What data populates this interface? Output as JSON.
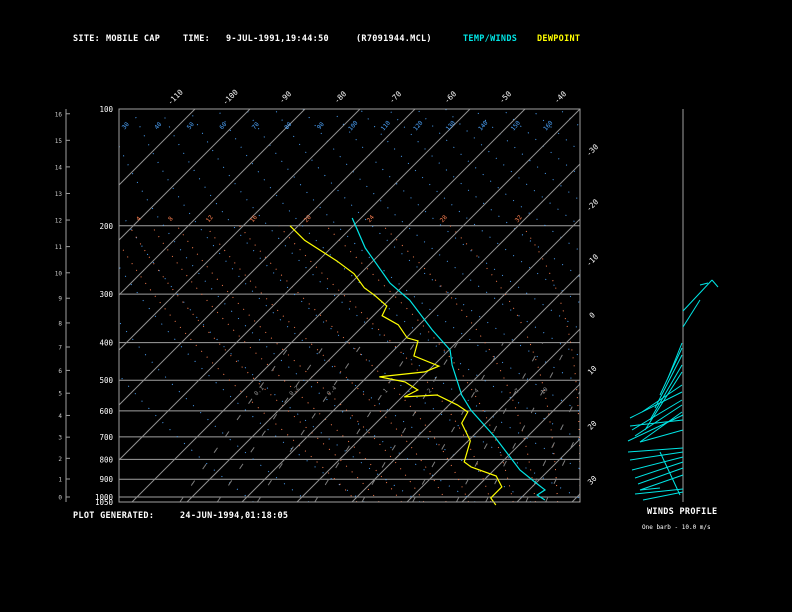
{
  "header": {
    "site_label": "SITE:",
    "site_value": "MOBILE CAP",
    "time_label": "TIME:",
    "time_value": "9-JUL-1991,19:44:50",
    "file_name": "(R7091944.MCL)",
    "legend_temp": "TEMP/WINDS",
    "legend_dew": "DEWPOINT"
  },
  "footer": {
    "generated_label": "PLOT GENERATED:",
    "generated_value": "24-JUN-1994,01:18:05"
  },
  "winds": {
    "title": "WINDS PROFILE",
    "note": "One barb - 10.0 m/s"
  },
  "colors": {
    "temperature": "#00e5e5",
    "dewpoint": "#ffff00",
    "dry_adiabat": "#4da6ff",
    "moist_adiabat": "#ff8050",
    "isotherm": "#909090",
    "isobar": "#a0a0a0",
    "background": "#000000"
  },
  "chart_data": {
    "type": "skew-t log-p",
    "pressure_axis": {
      "ticks": [
        "100",
        "200",
        "300",
        "400",
        "500",
        "600",
        "700",
        "800",
        "900",
        "1000",
        "1050"
      ],
      "range": [
        1050,
        100
      ],
      "scale": "log"
    },
    "height_axis_km": {
      "ticks": [
        "0",
        "1",
        "2",
        "3",
        "4",
        "5",
        "6",
        "7",
        "8",
        "9",
        "10",
        "11",
        "12",
        "13",
        "14",
        "15",
        "16"
      ]
    },
    "isotherm_labels_top": [
      "-110",
      "-100",
      "-90",
      "-80",
      "-70",
      "-60",
      "-50",
      "-40"
    ],
    "isotherm_labels_right": [
      "-30",
      "-20",
      "-10",
      "0",
      "10",
      "20",
      "30"
    ],
    "dry_adiabat_labels": [
      "30",
      "40",
      "50",
      "60",
      "70",
      "80",
      "90",
      "100",
      "110",
      "120",
      "130",
      "140",
      "150",
      "160"
    ],
    "moist_adiabat_labels": [
      "4",
      "8",
      "12",
      "16",
      "20",
      "24",
      "28",
      "32"
    ],
    "mixing_ratio_labels": [
      "0.1",
      "0.2",
      "0.4",
      "1",
      "2",
      "4",
      "7",
      "10",
      "16",
      "20"
    ],
    "series": [
      {
        "name": "TEMP/WINDS",
        "color": "#00e5e5",
        "points": [
          [
            191,
            -61.6
          ],
          [
            228,
            -53.8
          ],
          [
            281,
            -42.9
          ],
          [
            311,
            -36.2
          ],
          [
            371,
            -26.7
          ],
          [
            418,
            -19.8
          ],
          [
            457,
            -16.7
          ],
          [
            546,
            -9.5
          ],
          [
            597,
            -5.1
          ],
          [
            701,
            4.2
          ],
          [
            852,
            14.7
          ],
          [
            915,
            19.6
          ],
          [
            959,
            22.9
          ],
          [
            988,
            22.4
          ],
          [
            1018,
            24.7
          ]
        ]
      },
      {
        "name": "DEWPOINT",
        "color": "#ffff00",
        "points": [
          [
            200,
            -71.5
          ],
          [
            218,
            -66.2
          ],
          [
            246,
            -56.7
          ],
          [
            266,
            -51.1
          ],
          [
            289,
            -46.7
          ],
          [
            302,
            -43.5
          ],
          [
            322,
            -39.3
          ],
          [
            341,
            -38.4
          ],
          [
            360,
            -33.8
          ],
          [
            389,
            -29.8
          ],
          [
            396,
            -27.3
          ],
          [
            433,
            -25.3
          ],
          [
            460,
            -18.9
          ],
          [
            476,
            -20.4
          ],
          [
            490,
            -27.8
          ],
          [
            505,
            -22.2
          ],
          [
            530,
            -18.4
          ],
          [
            552,
            -19.6
          ],
          [
            546,
            -14
          ],
          [
            579,
            -8.5
          ],
          [
            604,
            -5.3
          ],
          [
            645,
            -4.4
          ],
          [
            717,
            0.4
          ],
          [
            812,
            3.1
          ],
          [
            837,
            5.3
          ],
          [
            883,
            11.5
          ],
          [
            942,
            14.5
          ],
          [
            1006,
            14.5
          ],
          [
            1049,
            16.7
          ]
        ]
      }
    ]
  }
}
